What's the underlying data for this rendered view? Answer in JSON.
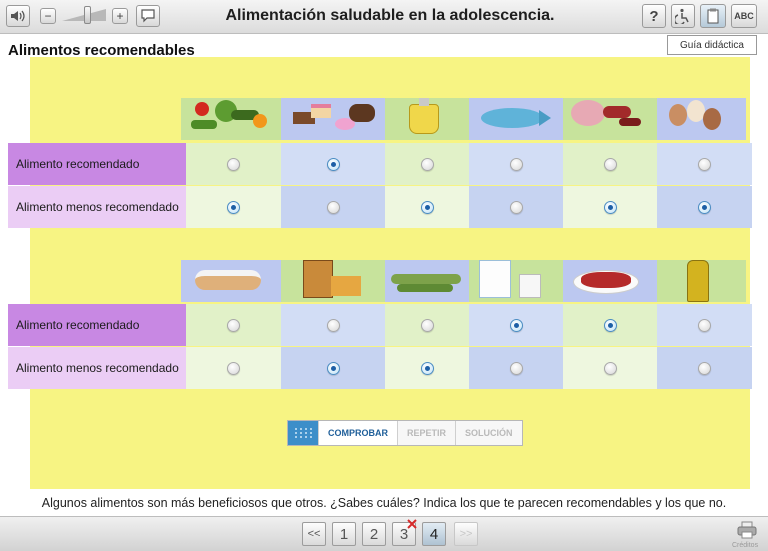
{
  "toolbar": {
    "title": "Alimentación saludable en la adolescencia.",
    "help_label": "?",
    "abc_label": "ABC",
    "minus_label": "−",
    "plus_label": "+",
    "guide_label": "Guía didáctica"
  },
  "section_title": "Alimentos recomendables",
  "row_labels": {
    "recommended": "Alimento recomendado",
    "less_recommended": "Alimento menos recomendado"
  },
  "tables": [
    {
      "foods": [
        "frutas-verduras-icon",
        "dulces-icon",
        "aceite-icon",
        "pescado-icon",
        "carnes-embutidos-icon",
        "huevos-icon"
      ],
      "recommended": [
        false,
        true,
        false,
        false,
        false,
        false
      ],
      "less_recommended": [
        true,
        false,
        true,
        false,
        true,
        true
      ]
    },
    {
      "foods": [
        "bolleria-icon",
        "cereales-icon",
        "legumbres-icon",
        "lacteos-icon",
        "carne-roja-icon",
        "aceite-botella-icon"
      ],
      "recommended": [
        false,
        false,
        false,
        true,
        true,
        false
      ],
      "less_recommended": [
        false,
        true,
        true,
        false,
        false,
        false
      ]
    }
  ],
  "actions": {
    "check": "COMPROBAR",
    "repeat": "REPETIR",
    "solution": "SOLUCIÓN"
  },
  "instructions": "Algunos alimentos son más beneficiosos que otros. ¿Sabes cuáles? Indica los que te parecen recomendables y los que no.",
  "pagination": {
    "first": "<<",
    "pages": [
      "1",
      "2",
      "3",
      "4"
    ],
    "current": "4",
    "next": ">>"
  },
  "credits": "Créditos",
  "colors": {
    "board": "#f7f483",
    "purple": "#c888e3",
    "lilac": "#ebcdf5",
    "green": "#e3f2c8",
    "blue": "#d2ddf5",
    "accent": "#3d8ec9"
  }
}
